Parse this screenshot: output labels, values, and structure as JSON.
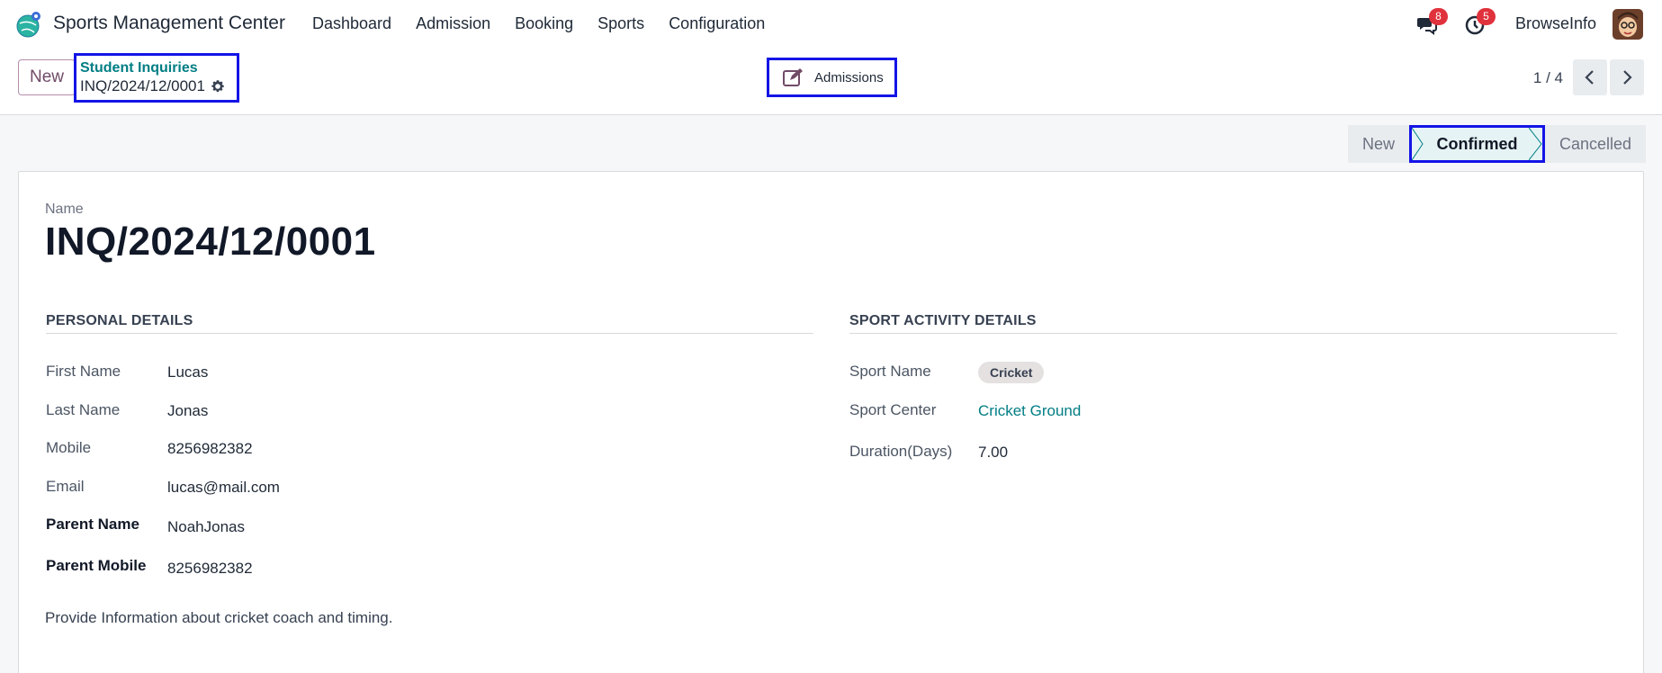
{
  "app": {
    "title": "Sports Management Center",
    "logo_icon": "sports-app-logo-icon"
  },
  "menu": {
    "items": [
      {
        "label": "Dashboard"
      },
      {
        "label": "Admission"
      },
      {
        "label": "Booking"
      },
      {
        "label": "Sports"
      },
      {
        "label": "Configuration"
      }
    ]
  },
  "nav_right": {
    "messages_count": "8",
    "activities_count": "5",
    "user_name": "BrowseInfo",
    "messages_icon": "chat-icon",
    "activities_icon": "clock-icon"
  },
  "control_panel": {
    "new_label": "New",
    "breadcrumb_parent": "Student Inquiries",
    "breadcrumb_current": "INQ/2024/12/0001",
    "smart_button_label": "Admissions",
    "pager_text": "1 / 4"
  },
  "statusbar": {
    "stages": [
      "New",
      "Confirmed",
      "Cancelled"
    ],
    "active": "Confirmed"
  },
  "record": {
    "name_caption": "Name",
    "name": "INQ/2024/12/0001"
  },
  "personal_details": {
    "title": "PERSONAL DETAILS",
    "first_name_label": "First Name",
    "first_name": "Lucas",
    "last_name_label": "Last Name",
    "last_name": "Jonas",
    "mobile_label": "Mobile",
    "mobile": "8256982382",
    "email_label": "Email",
    "email": "lucas@mail.com",
    "parent_name_label": "Parent Name",
    "parent_name": "NoahJonas",
    "parent_mobile_label": "Parent Mobile",
    "parent_mobile": "8256982382"
  },
  "sport_activity": {
    "title": "SPORT ACTIVITY DETAILS",
    "sport_name_label": "Sport Name",
    "sport_name": "Cricket",
    "sport_center_label": "Sport Center",
    "sport_center": "Cricket Ground",
    "duration_label": "Duration(Days)",
    "duration": "7.00"
  },
  "note": "Provide Information about cricket coach and timing.",
  "colors": {
    "brand": "#714b67",
    "link": "#017e84",
    "highlight": "#1414e6",
    "badge": "#e0323c"
  }
}
